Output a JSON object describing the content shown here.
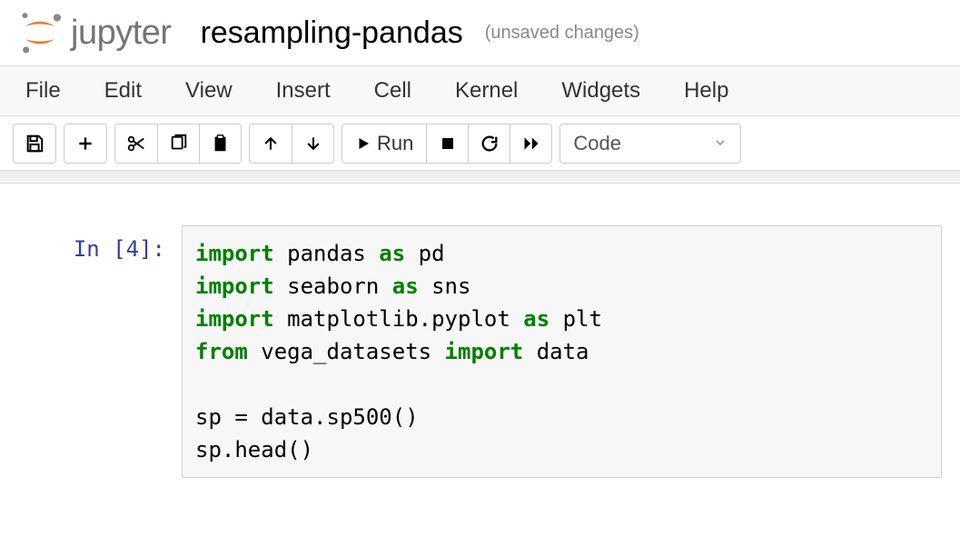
{
  "header": {
    "logo_text": "jupyter",
    "title": "resampling-pandas",
    "status": "(unsaved changes)"
  },
  "menu": {
    "file": "File",
    "edit": "Edit",
    "view": "View",
    "insert": "Insert",
    "cell": "Cell",
    "kernel": "Kernel",
    "widgets": "Widgets",
    "help": "Help"
  },
  "toolbar": {
    "run_label": "Run",
    "celltype_selected": "Code"
  },
  "cell": {
    "prompt": "In [4]:",
    "code": {
      "l1_kw1": "import",
      "l1_mod": " pandas ",
      "l1_kw2": "as",
      "l1_alias": " pd",
      "l2_kw1": "import",
      "l2_mod": " seaborn ",
      "l2_kw2": "as",
      "l2_alias": " sns",
      "l3_kw1": "import",
      "l3_mod": " matplotlib.pyplot ",
      "l3_kw2": "as",
      "l3_alias": " plt",
      "l4_kw1": "from",
      "l4_mod": " vega_datasets ",
      "l4_kw2": "import",
      "l4_imp": " data",
      "blank": "",
      "l6": "sp = data.sp500()",
      "l7": "sp.head()"
    }
  }
}
